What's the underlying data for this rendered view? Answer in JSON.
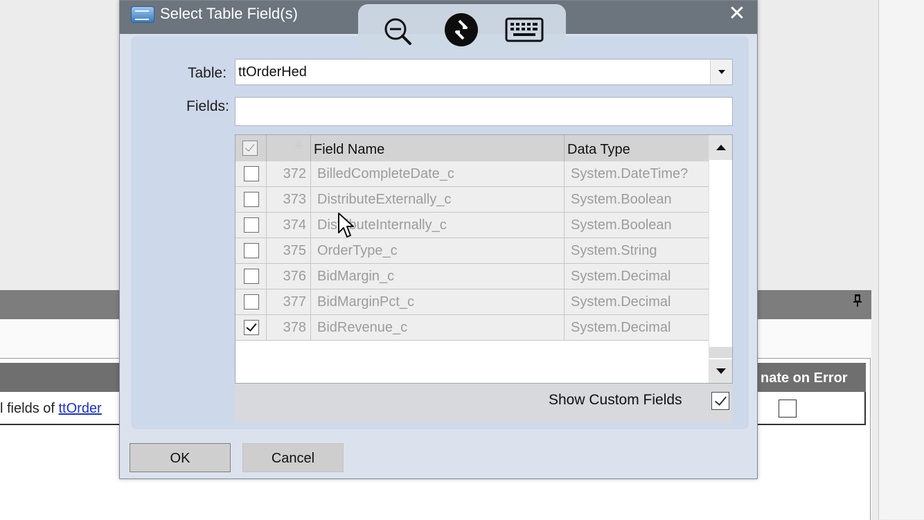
{
  "background": {
    "column_header_terminate": "nate on Error",
    "row": {
      "text_prefix": "l fields of ",
      "link_text": "ttOrder"
    },
    "pin_icon": "pin-icon"
  },
  "dialog": {
    "title": "Select Table Field(s)",
    "title_icon": "table-icon",
    "close_icon": "close-icon",
    "table_label": "Table:",
    "table_value": "ttOrderHed",
    "fields_label": "Fields:",
    "fields_value": "",
    "grid": {
      "columns": [
        "",
        "",
        "Field Name",
        "Data Type"
      ],
      "sort_icon": "sort-ascending-icon",
      "header_checkbox_checked": true,
      "rows": [
        {
          "checked": false,
          "number": "372",
          "name": "BilledCompleteDate_c",
          "type": "System.DateTime?"
        },
        {
          "checked": false,
          "number": "373",
          "name": "DistributeExternally_c",
          "type": "System.Boolean"
        },
        {
          "checked": false,
          "number": "374",
          "name": "DistributeInternally_c",
          "type": "System.Boolean"
        },
        {
          "checked": false,
          "number": "375",
          "name": "OrderType_c",
          "type": "System.String"
        },
        {
          "checked": false,
          "number": "376",
          "name": "BidMargin_c",
          "type": "System.Decimal"
        },
        {
          "checked": false,
          "number": "377",
          "name": "BidMarginPct_c",
          "type": "System.Decimal"
        },
        {
          "checked": true,
          "number": "378",
          "name": "BidRevenue_c",
          "type": "System.Decimal"
        }
      ]
    },
    "show_custom_fields_label": "Show Custom Fields",
    "show_custom_fields_checked": true,
    "ok_label": "OK",
    "cancel_label": "Cancel"
  },
  "remote_toolbar": {
    "icons": [
      "zoom-out-icon",
      "remote-connection-icon",
      "keyboard-icon"
    ]
  },
  "colors": {
    "dialog_bg": "#dbe2ee",
    "titlebar": "#6c747d",
    "content_panel": "#cdd9ea",
    "link": "#1a2fd6"
  }
}
